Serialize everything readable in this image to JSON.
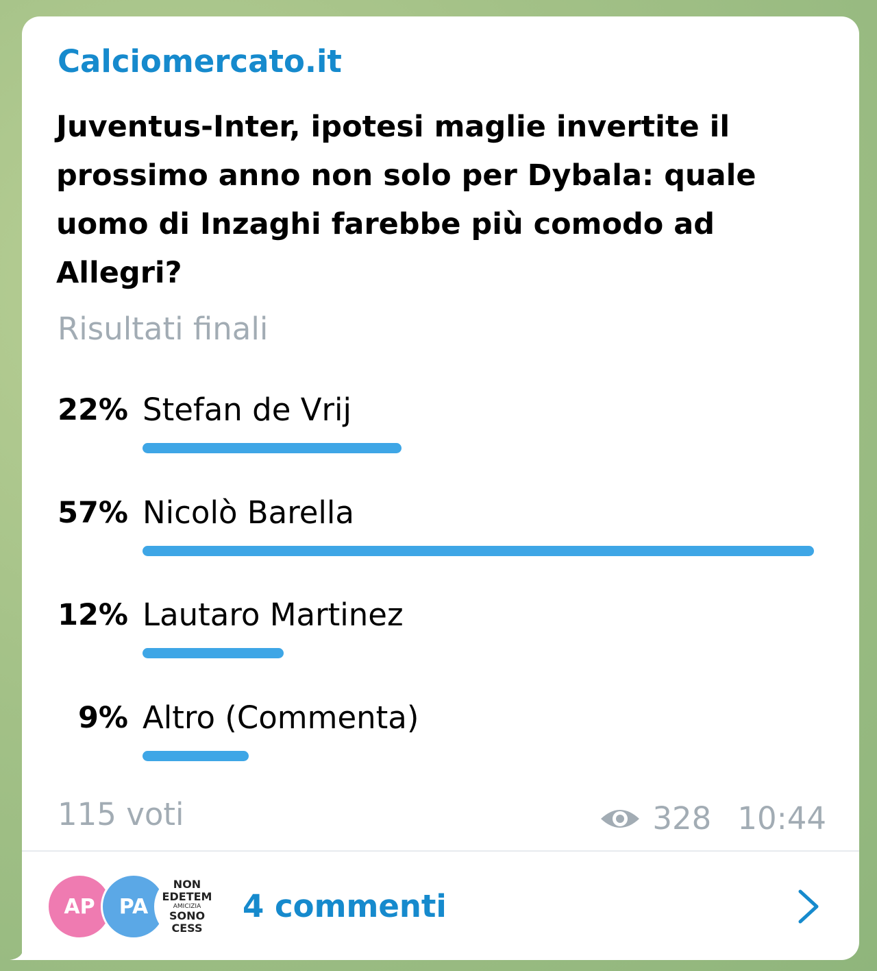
{
  "post": {
    "channel": "Calciomercato.it",
    "question": "Juventus-Inter, ipotesi maglie invertite il prossimo anno non solo per Dybala: quale uomo di Inzaghi farebbe più comodo ad Allegri?",
    "status": "Risultati finali",
    "options": [
      {
        "percent_label": "22%",
        "label": "Stefan de Vrij",
        "fraction": 0.22
      },
      {
        "percent_label": "57%",
        "label": "Nicolò Barella",
        "fraction": 0.57
      },
      {
        "percent_label": "12%",
        "label": "Lautaro Martinez",
        "fraction": 0.12
      },
      {
        "percent_label": "9%",
        "label": "Altro (Commenta)",
        "fraction": 0.09
      }
    ],
    "votes": "115 voti",
    "views": "328",
    "time": "10:44",
    "views_icon": "eye-icon"
  },
  "comments": {
    "avatars": [
      {
        "initials": "AP",
        "color": "#ef7bb1"
      },
      {
        "initials": "PA",
        "color": "#5ba8e6"
      },
      {
        "image_lines": [
          "NON",
          "EDETEM",
          "AMICIZIA",
          "SONO",
          "CESS"
        ]
      }
    ],
    "label": "4 commenti",
    "chevron_icon": "chevron-right-icon"
  },
  "colors": {
    "accent": "#168acd",
    "bar": "#3ea6e6",
    "muted": "#a2acb4",
    "bubble": "#ffffff"
  }
}
